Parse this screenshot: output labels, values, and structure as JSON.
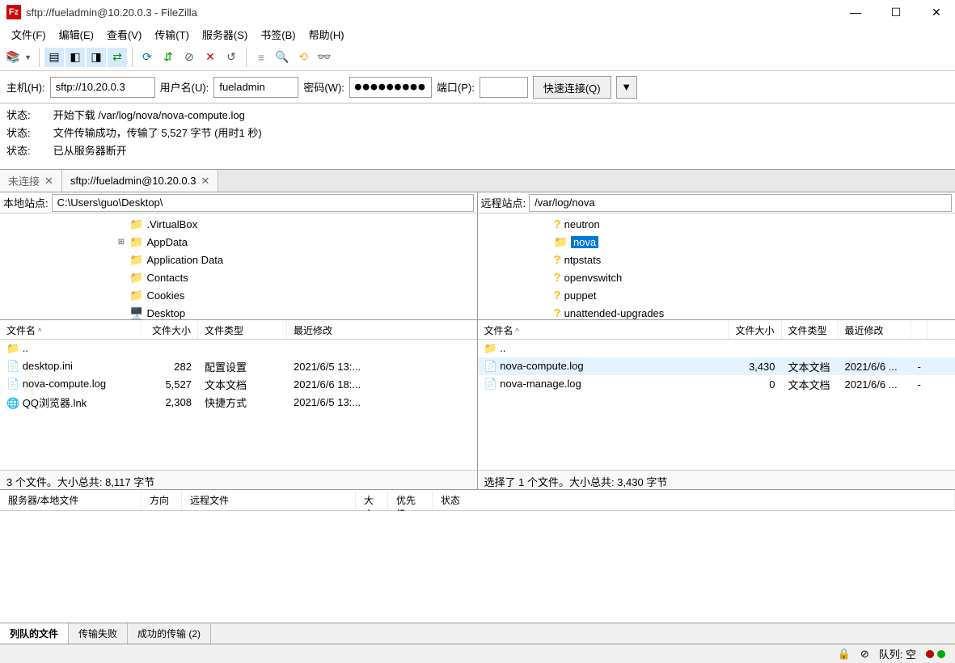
{
  "title": "sftp://fueladmin@10.20.0.3 - FileZilla",
  "menu": {
    "file": "文件(F)",
    "edit": "编辑(E)",
    "view": "查看(V)",
    "transfer": "传输(T)",
    "server": "服务器(S)",
    "bookmarks": "书签(B)",
    "help": "帮助(H)"
  },
  "quick": {
    "host_lbl": "主机(H):",
    "host": "sftp://10.20.0.3",
    "user_lbl": "用户名(U):",
    "user": "fueladmin",
    "pass_lbl": "密码(W):",
    "pass": "●●●●●●●●●",
    "port_lbl": "端口(P):",
    "port": "",
    "connect": "快速连接(Q)"
  },
  "log": {
    "l1": "状态:\t开始下载 /var/log/nova/nova-compute.log",
    "l2": "状态:\t文件传输成功，传输了 5,527 字节 (用时1 秒)",
    "l3": "状态:\t已从服务器断开"
  },
  "tabs": {
    "t1": "未连接",
    "t2": "sftp://fueladmin@10.20.0.3"
  },
  "local": {
    "label": "本地站点:",
    "path": "C:\\Users\\guo\\Desktop\\",
    "tree": [
      {
        "name": ".VirtualBox",
        "indent": 140
      },
      {
        "name": "AppData",
        "indent": 140,
        "exp": "⊞"
      },
      {
        "name": "Application Data",
        "indent": 140
      },
      {
        "name": "Contacts",
        "indent": 140
      },
      {
        "name": "Cookies",
        "indent": 140
      },
      {
        "name": "Desktop",
        "indent": 140,
        "special": true
      }
    ],
    "cols": {
      "name": "文件名",
      "size": "文件大小",
      "type": "文件类型",
      "mtime": "最近修改"
    },
    "files": [
      {
        "icon": "📁",
        "name": ".."
      },
      {
        "icon": "📄",
        "name": "desktop.ini",
        "size": "282",
        "type": "配置设置",
        "mtime": "2021/6/5 13:..."
      },
      {
        "icon": "📄",
        "name": "nova-compute.log",
        "size": "5,527",
        "type": "文本文档",
        "mtime": "2021/6/6 18:..."
      },
      {
        "icon": "🌐",
        "name": "QQ浏览器.lnk",
        "size": "2,308",
        "type": "快捷方式",
        "mtime": "2021/6/5 13:..."
      }
    ],
    "status": "3 个文件。大小总共: 8,117 字节"
  },
  "remote": {
    "label": "远程站点:",
    "path": "/var/log/nova",
    "tree": [
      {
        "name": "neutron",
        "q": true
      },
      {
        "name": "nova",
        "sel": true
      },
      {
        "name": "ntpstats",
        "q": true
      },
      {
        "name": "openvswitch",
        "q": true
      },
      {
        "name": "puppet",
        "q": true
      },
      {
        "name": "unattended-upgrades",
        "q": true
      }
    ],
    "cols": {
      "name": "文件名",
      "size": "文件大小",
      "type": "文件类型",
      "mtime": "最近修改"
    },
    "files": [
      {
        "icon": "📁",
        "name": ".."
      },
      {
        "icon": "📄",
        "name": "nova-compute.log",
        "size": "3,430",
        "type": "文本文档",
        "mtime": "2021/6/6 ...",
        "sel": true,
        "extra": "-"
      },
      {
        "icon": "📄",
        "name": "nova-manage.log",
        "size": "0",
        "type": "文本文档",
        "mtime": "2021/6/6 ...",
        "extra": "-"
      }
    ],
    "status": "选择了 1 个文件。大小总共: 3,430 字节"
  },
  "queue": {
    "cols": {
      "server": "服务器/本地文件",
      "dir": "方向",
      "remote": "远程文件",
      "size": "大小",
      "prio": "优先级",
      "status": "状态"
    },
    "tabs": {
      "files": "列队的文件",
      "failed": "传输失败",
      "success": "成功的传输 (2)"
    }
  },
  "statusbar": {
    "queue": "队列: 空"
  }
}
